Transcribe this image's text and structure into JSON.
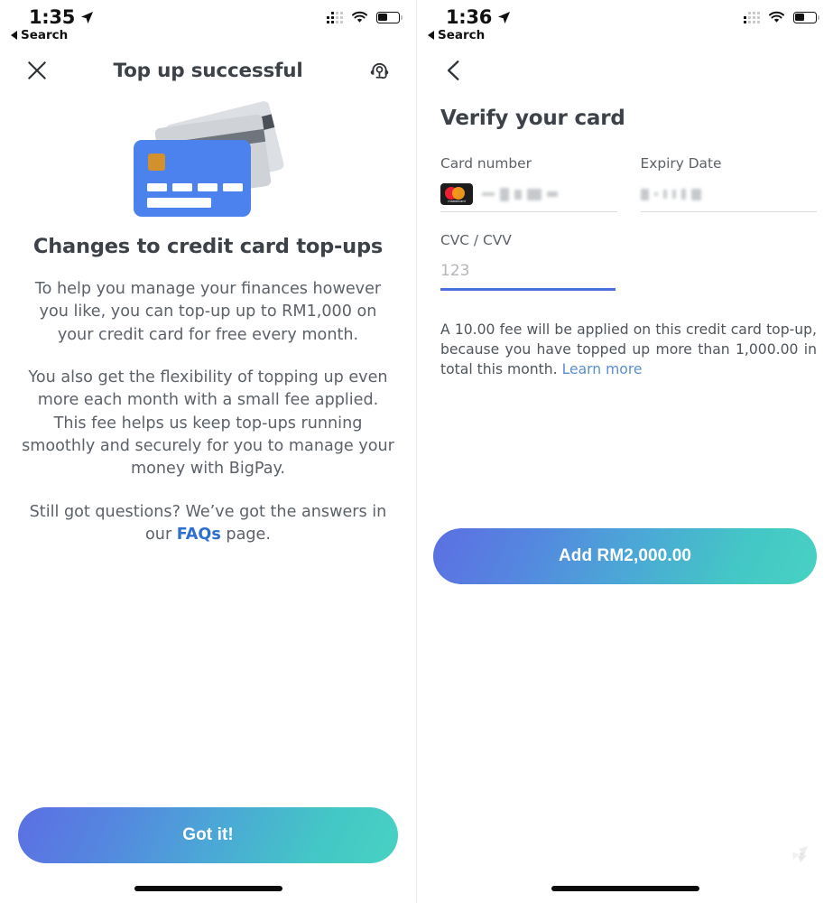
{
  "left_screen": {
    "status_bar": {
      "time": "1:35",
      "back_label": "Search",
      "location_icon": "location-arrow-icon",
      "cellular_icon": "cellular-signal-icon",
      "wifi_icon": "wifi-icon",
      "battery_icon": "battery-icon",
      "battery_level_pct": 46
    },
    "nav": {
      "close_icon": "close-icon",
      "title": "Top up successful",
      "support_icon": "headset-support-icon"
    },
    "illustration": {
      "name": "credit-cards-illustration",
      "front_card_color": "#4c82ed",
      "chip_color": "#d2912c",
      "back_card_color": "#cfd3d8",
      "back_card_stripe_color": "#4b5058"
    },
    "heading": "Changes to credit card top-ups",
    "paragraphs": [
      "To help you manage your finances however you like, you can top-up up to RM1,000 on your credit card for free every month.",
      "You also get the flexibility of topping up even more each month with a small fee applied. This fee helps us keep top-ups running smoothly and securely for you to manage your money with BigPay."
    ],
    "faq_paragraph": {
      "before": "Still got questions? We’ve got the answers in our ",
      "link": "FAQs",
      "after": " page."
    },
    "cta_label": "Got it!"
  },
  "right_screen": {
    "status_bar": {
      "time": "1:36",
      "back_label": "Search",
      "location_icon": "location-arrow-icon",
      "cellular_icon": "cellular-signal-icon",
      "wifi_icon": "wifi-icon",
      "battery_icon": "battery-icon",
      "battery_level_pct": 46
    },
    "nav": {
      "back_icon": "chevron-left-icon"
    },
    "heading": "Verify your card",
    "fields": {
      "card_number": {
        "label": "Card number",
        "brand_icon": "mastercard-icon",
        "brand_word": "mastercard",
        "value_state": "redacted"
      },
      "expiry_date": {
        "label": "Expiry Date",
        "value_state": "redacted"
      },
      "cvc": {
        "label": "CVC / CVV",
        "placeholder": "123",
        "value": "",
        "focused": true,
        "focus_color": "#4c6fe0"
      }
    },
    "fee_note": {
      "before": "A 10.00 fee will be applied on this credit card top-up, because you have topped up more than 1,000.00 in total this month. ",
      "link": "Learn more",
      "fee_amount": "10.00",
      "threshold_amount": "1,000.00"
    },
    "cta_label": "Add RM2,000.00",
    "watermark_icon": "bigpay-logo-watermark"
  },
  "theme": {
    "cta_gradient_start": "#5c6fe2",
    "cta_gradient_end": "#47d2c2",
    "link_blue": "#2f6fd0",
    "text_dark": "#3c4247",
    "text_body": "#5c6268"
  }
}
